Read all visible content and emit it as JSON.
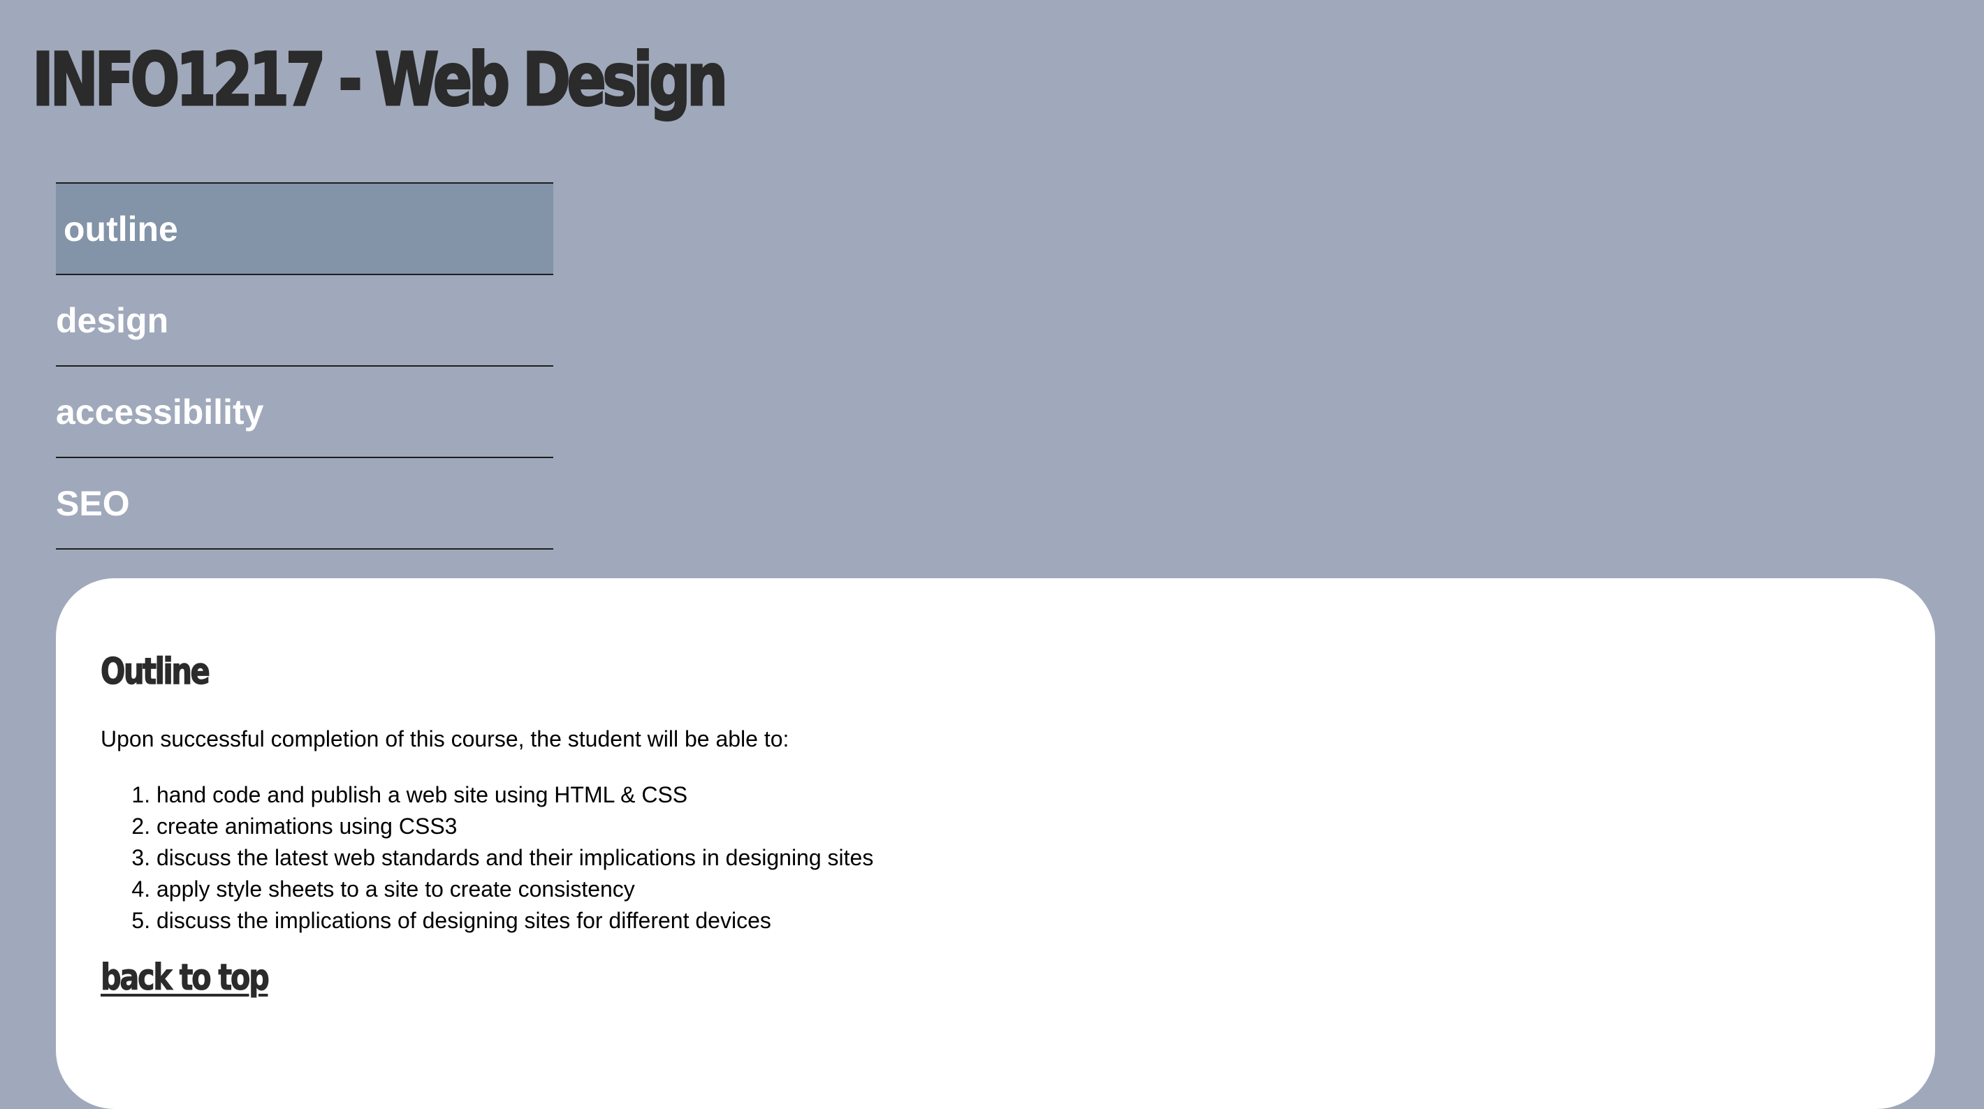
{
  "header": {
    "title": "INFO1217 - Web Design"
  },
  "nav": {
    "items": [
      {
        "label": "outline",
        "active": true
      },
      {
        "label": "design",
        "active": false
      },
      {
        "label": "accessibility",
        "active": false
      },
      {
        "label": "SEO",
        "active": false
      }
    ]
  },
  "main": {
    "heading": "Outline",
    "intro": "Upon successful completion of this course, the student will be able to:",
    "outcomes": [
      "hand code and publish a web site using HTML & CSS",
      "create animations using CSS3",
      "discuss the latest web standards and their implications in designing sites",
      "apply style sheets to a site to create consistency",
      "discuss the implications of designing sites for different devices"
    ],
    "back_to_top": "back to top"
  },
  "colors": {
    "background": "#a0a9bb",
    "active_nav": "#8393a8",
    "card": "#ffffff",
    "heading_text": "#2b2b2b",
    "nav_text": "#ffffff"
  }
}
